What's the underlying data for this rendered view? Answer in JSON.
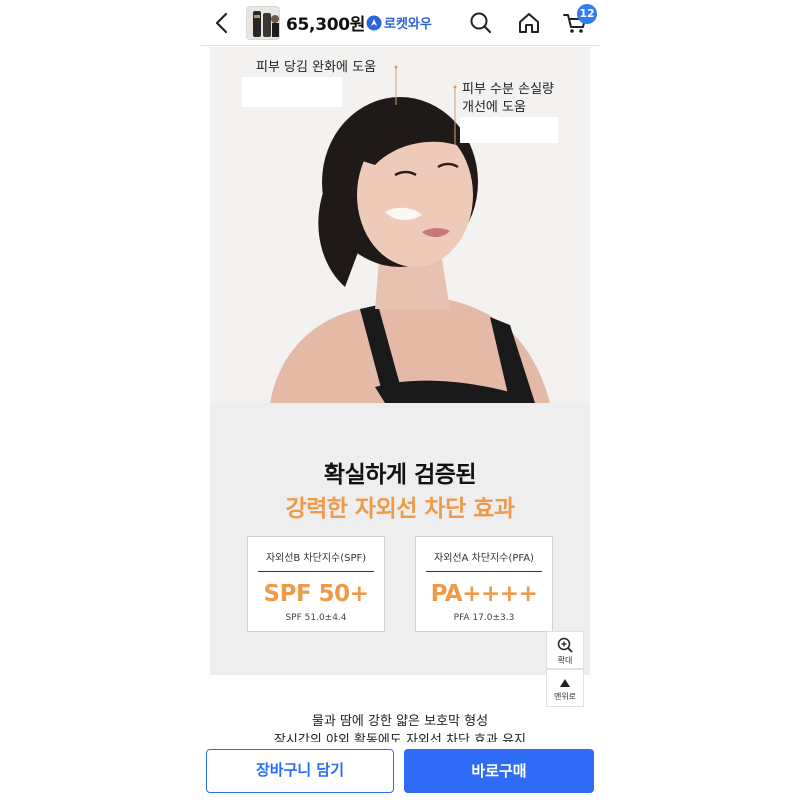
{
  "header": {
    "price": "65,300원",
    "delivery_badge": "로켓와우",
    "cart_count": "12"
  },
  "hero": {
    "callout_left": "피부 당김 완화에 도움",
    "callout_right_line1": "피부 수분 손실량",
    "callout_right_line2": "개선에 도움"
  },
  "efficacy": {
    "title_line1": "확실하게 검증된",
    "title_line2": "강력한 자외선 차단 효과",
    "cards": [
      {
        "label": "자외선B 차단지수(SPF)",
        "value": "SPF 50+",
        "sub": "SPF 51.0±4.4"
      },
      {
        "label": "자외선A 차단지수(PFA)",
        "value": "PA++++",
        "sub": "PFA 17.0±3.3"
      }
    ]
  },
  "floating": {
    "zoom_label": "확대",
    "top_label": "맨위로"
  },
  "description": {
    "line1": "물과 땀에 강한 얇은 보호막 형성",
    "line2": "장시간의 야외 활동에도 자외선 차단 효과 유지"
  },
  "actions": {
    "add_to_cart": "장바구니 담기",
    "buy_now": "바로구매"
  },
  "colors": {
    "accent_blue": "#2f6cf5",
    "accent_orange": "#ee9a4a"
  }
}
